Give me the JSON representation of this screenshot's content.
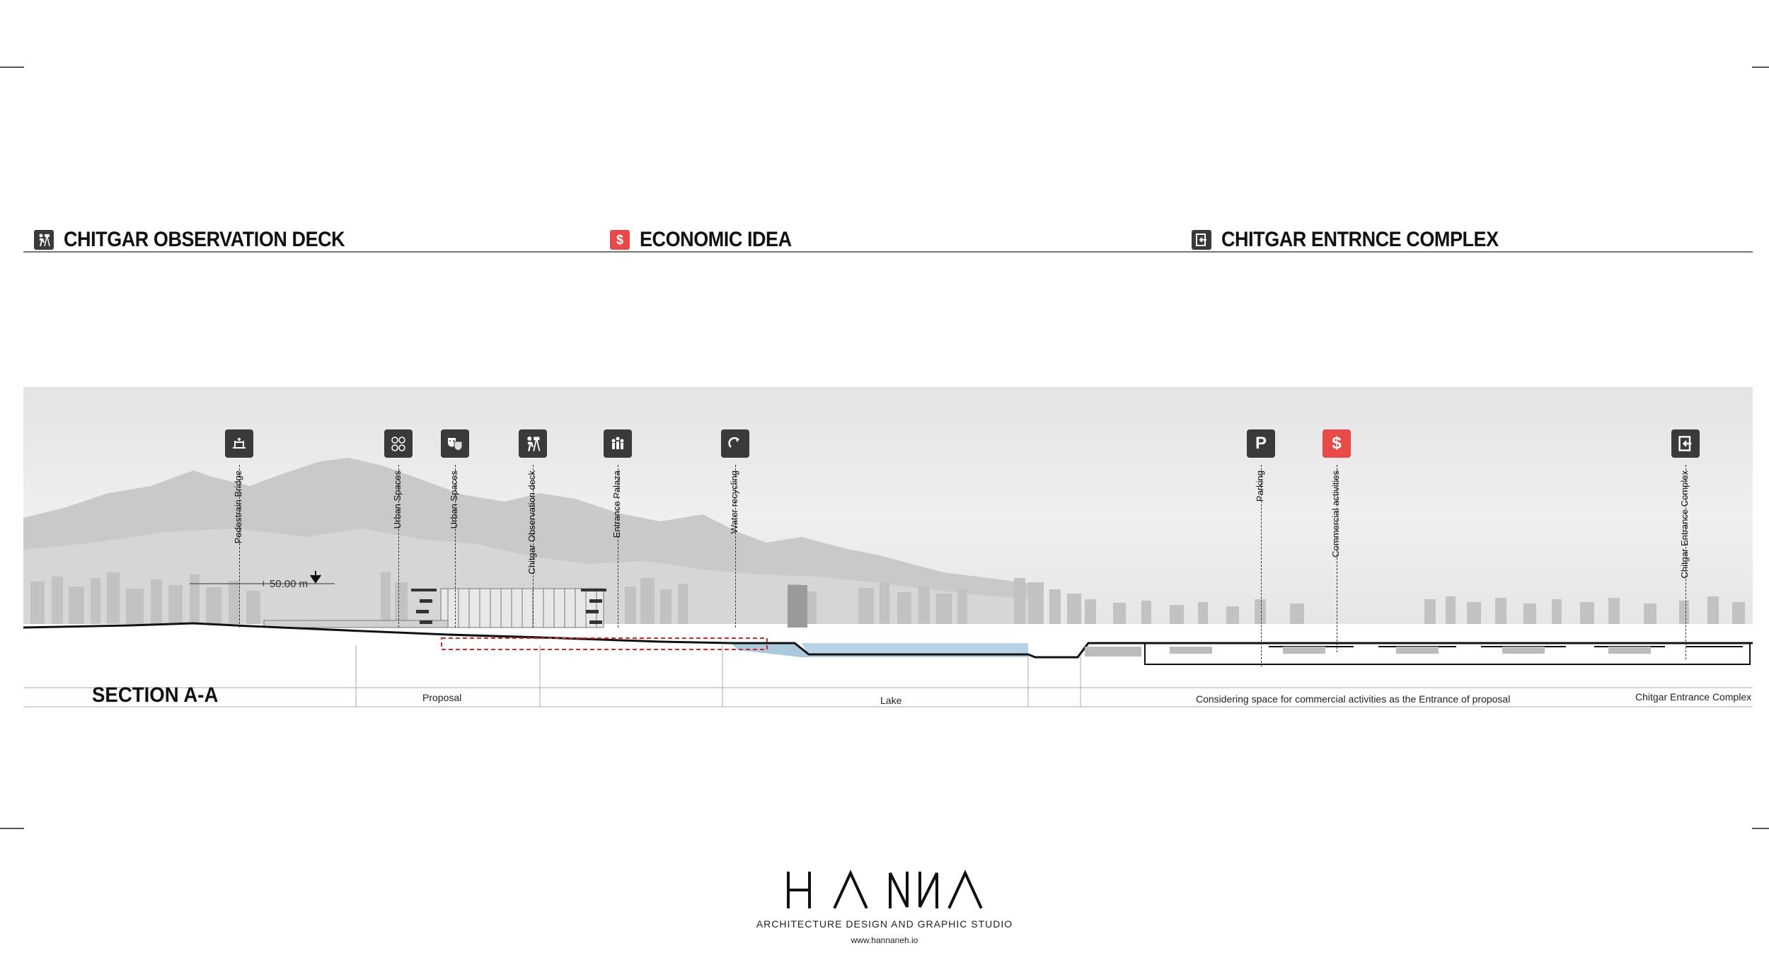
{
  "headers": [
    {
      "icon": "observation-icon",
      "label": "CHITGAR OBSERVATION DECK",
      "accent": "#3a3a3a"
    },
    {
      "icon": "dollar-icon",
      "label": "ECONOMIC IDEA",
      "accent": "#e84a4a"
    },
    {
      "icon": "entrance-icon",
      "label": "CHITGAR ENTRNCE COMPLEX",
      "accent": "#3a3a3a"
    }
  ],
  "section": {
    "title": "SECTION A-A",
    "elevation": "+ 50.00 m",
    "markers": [
      {
        "icon": "bridge-icon",
        "label": "Pedestrain Bridge",
        "color": "#3a3a3a"
      },
      {
        "icon": "people-network-icon",
        "label": "Urban Spaces",
        "color": "#3a3a3a"
      },
      {
        "icon": "theater-masks-icon",
        "label": "Urban Spaces",
        "color": "#3a3a3a"
      },
      {
        "icon": "observation-icon",
        "label": "Chitgar Observation deck",
        "color": "#3a3a3a"
      },
      {
        "icon": "plaza-icon",
        "label": "Entrance Palaza",
        "color": "#3a3a3a"
      },
      {
        "icon": "recycle-arrow-icon",
        "label": "Water recycling",
        "color": "#3a3a3a"
      },
      {
        "icon": "parking-icon",
        "label": "Parking",
        "color": "#3a3a3a"
      },
      {
        "icon": "dollar-icon",
        "label": "Commercial activities",
        "color": "#e84a4a"
      },
      {
        "icon": "entrance-icon",
        "label": "Chitgar Entrance Complex",
        "color": "#3a3a3a"
      }
    ],
    "zones": [
      {
        "label": "Proposal"
      },
      {
        "label": "Lake"
      },
      {
        "label": "Considering space for commercial activities as the Entrance of proposal"
      },
      {
        "label": "Chitgar Entrance Complex"
      }
    ]
  },
  "footer": {
    "logo": "HANNA",
    "studio": "ARCHITECTURE DESIGN AND GRAPHIC STUDIO",
    "url": "www.hannaneh.io"
  }
}
